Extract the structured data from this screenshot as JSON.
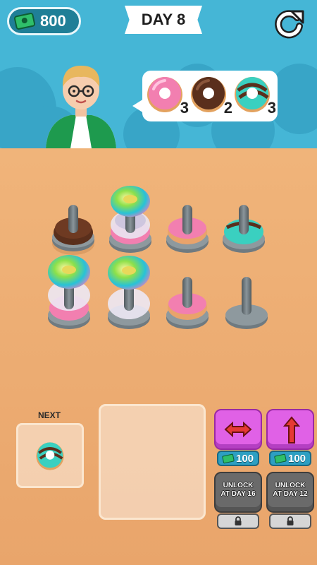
{
  "hud": {
    "cash": "800",
    "day": "DAY 8"
  },
  "order": {
    "items": [
      {
        "donut": "pink-donut",
        "count": "3"
      },
      {
        "donut": "chocolate-donut",
        "count": "2"
      },
      {
        "donut": "mint-chocolate-donut",
        "count": "3"
      }
    ]
  },
  "next": {
    "label": "NEXT",
    "donut": "mint-chocolate-donut"
  },
  "tools": [
    {
      "name": "swap-tool",
      "price": "100",
      "locked": false
    },
    {
      "name": "lift-tool",
      "price": "100",
      "locked": false
    },
    {
      "name": "locked-tool-1",
      "unlock_line1": "UNLOCK",
      "unlock_line2": "AT DAY 16",
      "locked": true
    },
    {
      "name": "locked-tool-2",
      "unlock_line1": "UNLOCK",
      "unlock_line2": "AT DAY 12",
      "locked": true
    }
  ],
  "pegs": [
    {
      "row": 1,
      "col": 1,
      "stack": [
        "chocolate-donut"
      ]
    },
    {
      "row": 1,
      "col": 2,
      "stack": [
        "pink-donut",
        "glass-ring",
        "rainbow-donut"
      ]
    },
    {
      "row": 1,
      "col": 3,
      "stack": [
        "pink-donut"
      ]
    },
    {
      "row": 1,
      "col": 4,
      "stack": [
        "mint-chocolate-donut"
      ]
    },
    {
      "row": 2,
      "col": 1,
      "stack": [
        "pink-donut",
        "glass-ring",
        "rainbow-donut"
      ]
    },
    {
      "row": 2,
      "col": 2,
      "stack": [
        "glass-ring",
        "rainbow-donut"
      ]
    },
    {
      "row": 2,
      "col": 3,
      "stack": [
        "pink-donut"
      ]
    },
    {
      "row": 2,
      "col": 4,
      "stack": []
    }
  ],
  "colors": {
    "sky": "#45b6d6",
    "table": "#ee af75",
    "pink_donut": "#f27fb0",
    "chocolate": "#5a2f1c",
    "mint_icing": "#3ad0c0",
    "peg": "#6f7a80",
    "tool_purple": "#e061e6",
    "locked_gray": "#6a6a6a"
  }
}
